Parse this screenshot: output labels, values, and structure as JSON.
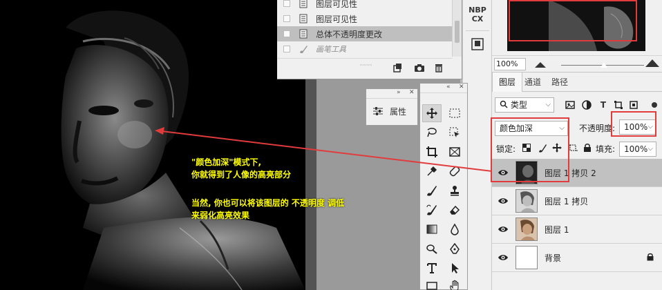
{
  "history": {
    "items": [
      {
        "label": "图层可见性",
        "icon": "document-icon",
        "state": "normal"
      },
      {
        "label": "图层可见性",
        "icon": "document-icon",
        "state": "normal"
      },
      {
        "label": "总体不透明度更改",
        "icon": "document-icon",
        "state": "selected"
      },
      {
        "label": "画笔工具",
        "icon": "brush-icon",
        "state": "dim"
      }
    ],
    "footer_icons": [
      "new-snapshot-icon",
      "camera-icon",
      "trash-icon"
    ]
  },
  "iconstrip": {
    "badge_line1": "NBP",
    "badge_line2": "CX"
  },
  "properties": {
    "label": "属性"
  },
  "navigator": {
    "zoom": "100%"
  },
  "layers": {
    "tabs": [
      "图层",
      "通道",
      "路径"
    ],
    "active_tab": "图层",
    "filter_label": "类型",
    "blend_mode": "颜色加深",
    "opacity_label": "不透明度:",
    "opacity_value": "100%",
    "lock_label": "锁定:",
    "fill_label": "填充:",
    "fill_value": "100%",
    "rows": [
      {
        "name": "图层 1 拷贝 2",
        "selected": true,
        "locked": false
      },
      {
        "name": "图层 1 拷贝",
        "selected": false,
        "locked": false
      },
      {
        "name": "图层 1",
        "selected": false,
        "locked": false
      },
      {
        "name": "背景",
        "selected": false,
        "locked": true
      }
    ]
  },
  "annotation": {
    "line1": "\"颜色加深\"模式下,",
    "line2": "你就得到了人像的高亮部分",
    "line3": "当然, 你也可以将该图层的 不透明度 调低",
    "line4": "来弱化高亮效果"
  },
  "colors": {
    "accent_red": "#e23b3b",
    "annotation_yellow": "#ffff00",
    "panel_bg": "#f0f0f0"
  }
}
